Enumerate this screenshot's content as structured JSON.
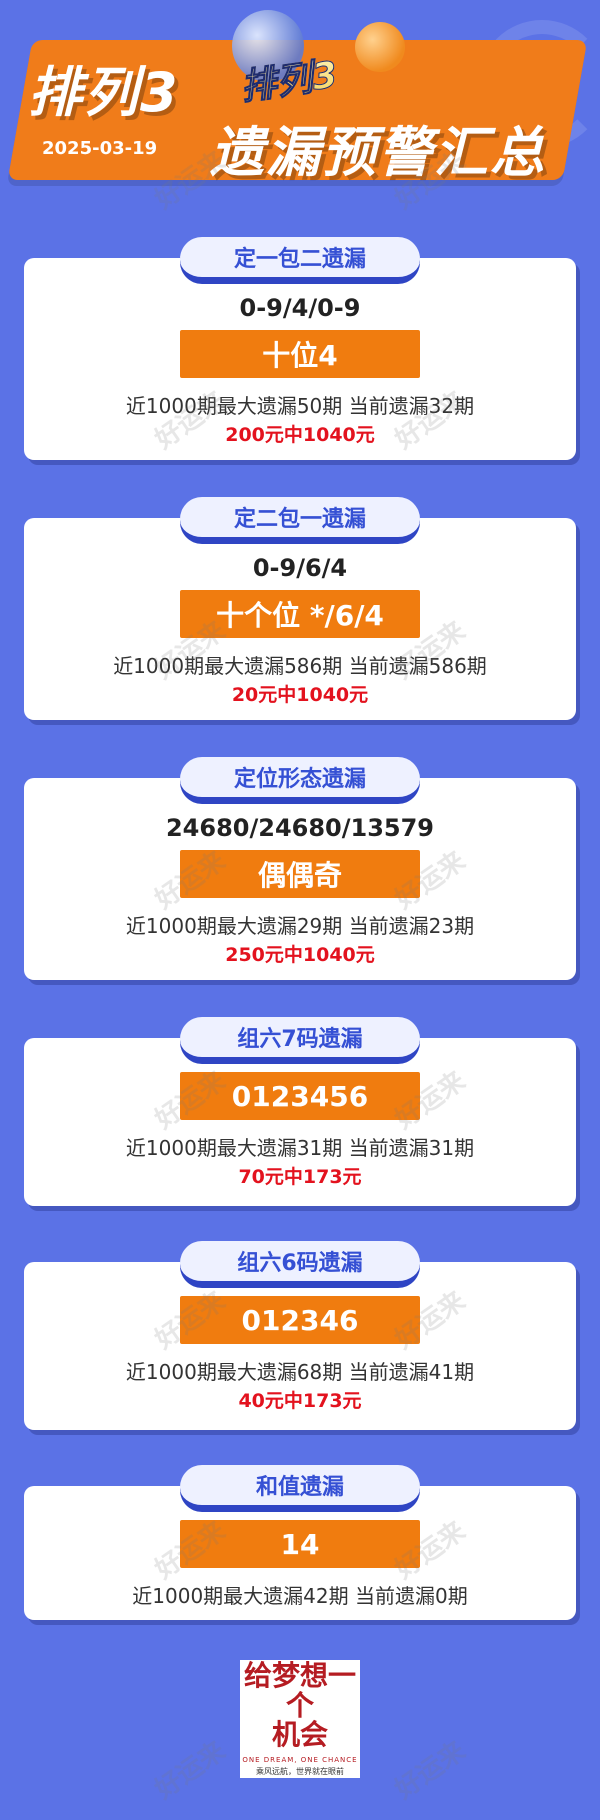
{
  "header": {
    "title_left": "排列3",
    "date": "2025-03-19",
    "small_title": "排列3",
    "title_right": "遗漏预警汇总"
  },
  "watermark": "好运来",
  "cards": [
    {
      "tab": "定一包二遗漏",
      "line1": "0-9/4/0-9",
      "bar": "十位4",
      "stats": "近1000期最大遗漏50期 当前遗漏32期",
      "odds": "200元中1040元"
    },
    {
      "tab": "定二包一遗漏",
      "line1": "0-9/6/4",
      "bar": "十个位 */6/4",
      "stats": "近1000期最大遗漏586期 当前遗漏586期",
      "odds": "20元中1040元"
    },
    {
      "tab": "定位形态遗漏",
      "line1": "24680/24680/13579",
      "bar": "偶偶奇",
      "stats": "近1000期最大遗漏29期 当前遗漏23期",
      "odds": "250元中1040元"
    },
    {
      "tab": "组六7码遗漏",
      "bar": "0123456",
      "stats": "近1000期最大遗漏31期 当前遗漏31期",
      "odds": "70元中173元"
    },
    {
      "tab": "组六6码遗漏",
      "bar": "012346",
      "stats": "近1000期最大遗漏68期 当前遗漏41期",
      "odds": "40元中173元"
    },
    {
      "tab": "和值遗漏",
      "bar": "14",
      "stats": "近1000期最大遗漏42期 当前遗漏0期"
    }
  ],
  "logo": {
    "main_line1": "给梦想一个",
    "main_line2": "机会",
    "sub_en": "ONE DREAM, ONE CHANCE",
    "sub_cn": "乘风远航，世界就在眼前"
  }
}
